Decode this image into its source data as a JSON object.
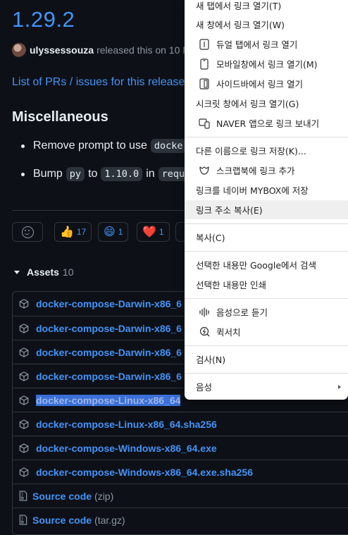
{
  "release": {
    "version": "1.29.2",
    "author": "ulyssessouza",
    "released_text": "released this on 10 N",
    "prs_link": "List of PRs / issues for this release",
    "heading": "Miscellaneous",
    "bullet1": {
      "text": "Remove prompt to use",
      "code": "docke"
    },
    "bullet2": {
      "text_a": "Bump",
      "code_a": "py",
      "text_b": "to",
      "code_b": "1.10.0",
      "text_c": "in",
      "code_c": "requ"
    }
  },
  "reactions": [
    {
      "emoji": "👍",
      "count": "17"
    },
    {
      "emoji": "😄",
      "count": "1"
    },
    {
      "emoji": "❤️",
      "count": "1"
    }
  ],
  "assets": {
    "title": "Assets",
    "count": "10",
    "items": [
      {
        "name": "docker-compose-Darwin-x86_6"
      },
      {
        "name": "docker-compose-Darwin-x86_6"
      },
      {
        "name": "docker-compose-Darwin-x86_6"
      },
      {
        "name": "docker-compose-Darwin-x86_6"
      },
      {
        "name": "docker-compose-Linux-x86_64"
      },
      {
        "name": "docker-compose-Linux-x86_64.sha256"
      },
      {
        "name": "docker-compose-Windows-x86_64.exe"
      },
      {
        "name": "docker-compose-Windows-x86_64.exe.sha256"
      }
    ],
    "source_zip": {
      "name": "Source code",
      "ext": "(zip)"
    },
    "source_tar": {
      "name": "Source code",
      "ext": "(tar.gz)"
    }
  },
  "context_menu": {
    "open_new_tab": "새 탭에서 링크 열기(T)",
    "open_new_window": "새 창에서 링크 열기(W)",
    "open_dual_tab": "듀얼 탭에서 링크 열기",
    "open_mobile_window": "모바일창에서 링크 열기(M)",
    "open_sidebar": "사이드바에서 링크 열기",
    "open_secret_window": "시크릿 창에서 링크 열기(G)",
    "send_naver_app": "NAVER 앱으로 링크 보내기",
    "save_link_as": "다른 이름으로 링크 저장(K)...",
    "add_scrapbook": "스크랩북에 링크 추가",
    "save_mybox": "링크를 네이버 MYBOX에 저장",
    "copy_link_address": "링크 주소 복사(E)",
    "copy": "복사(C)",
    "search_google": "선택한 내용만 Google에서 검색",
    "print_selection": "선택한 내용만 인쇄",
    "listen_voice": "음성으로 듣기",
    "quick_search": "퀵서치",
    "inspect": "검사(N)",
    "voice": "음성"
  }
}
